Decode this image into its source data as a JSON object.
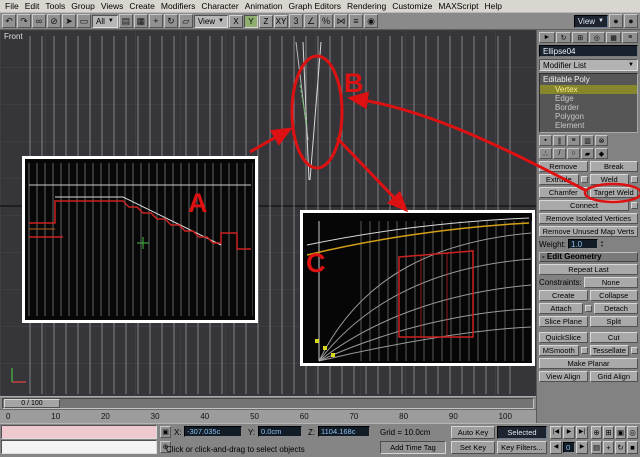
{
  "menu": {
    "items": [
      "File",
      "Edit",
      "Tools",
      "Group",
      "Views",
      "Create",
      "Modifiers",
      "Character",
      "Animation",
      "Graph Editors",
      "Rendering",
      "Customize",
      "MAXScript",
      "Help"
    ]
  },
  "toolbar": {
    "icons_left": [
      "↶",
      "↷",
      "∞",
      "⊘",
      "➤",
      "▭"
    ],
    "filter_label": "All",
    "icons_sel": [
      "▤",
      "▦"
    ],
    "icons_xform": [
      "+",
      "↻",
      "▱"
    ],
    "ref_coord_label": "View",
    "axis_x": "X",
    "axis_y": "Y",
    "axis_z": "Z",
    "axis_xy": "XY",
    "icons_snap": [
      "3",
      "∠",
      "%"
    ],
    "icons_misc": [
      "⋈",
      "≡",
      "◉"
    ],
    "view_label": "View",
    "icons_right": [
      "●",
      "●"
    ]
  },
  "viewport": {
    "label": "Front"
  },
  "annotations": {
    "a_label": "A",
    "b_label": "B",
    "c_label": "C"
  },
  "command_panel": {
    "tabs": [
      "►",
      "↻",
      "⊞",
      "◎",
      "▦",
      "≡"
    ],
    "object_name": "Ellipse04",
    "modifier_list_label": "Modifier List",
    "stack": {
      "root": "Editable Poly",
      "items": [
        "Vertex",
        "Edge",
        "Border",
        "Polygon",
        "Element"
      ]
    },
    "stack_tools": [
      "▪",
      "∥",
      "≡",
      "▥",
      "⊗"
    ],
    "selection_icons": [
      "∴",
      "/",
      "○",
      "▰",
      "◆"
    ],
    "edit_vertices": {
      "remove": "Remove",
      "break": "Break",
      "extrude": "Extrude",
      "weld": "Weld",
      "chamfer": "Chamfer",
      "target_weld": "Target Weld",
      "connect": "Connect",
      "remove_isolated": "Remove Isolated Vertices",
      "remove_unused": "Remove Unused Map Verts",
      "weight_label": "Weight:",
      "weight_value": "1.0"
    },
    "edit_geometry": {
      "header": "- Edit Geometry",
      "repeat_last": "Repeat Last",
      "constraints_label": "Constraints:",
      "constraints_value": "None",
      "create": "Create",
      "collapse": "Collapse",
      "attach": "Attach",
      "detach": "Detach",
      "slice_plane": "Slice Plane",
      "split": "Split",
      "quickslice": "QuickSlice",
      "cut": "Cut",
      "msmooth": "MSmooth",
      "tessellate": "Tessellate",
      "make_planar": "Make Planar",
      "view_align": "View Align",
      "grid_align": "Grid Align"
    }
  },
  "timeline": {
    "slider_label": "0 / 100",
    "ticks": [
      "0",
      "10",
      "20",
      "30",
      "40",
      "50",
      "60",
      "70",
      "80",
      "90",
      "100"
    ]
  },
  "status_bar": {
    "x_label": "X:",
    "x_value": "-307.035c",
    "y_label": "Y:",
    "y_value": "0.0cm",
    "z_label": "Z:",
    "z_value": "1104.168c",
    "grid_label": "Grid = 10.0cm",
    "prompt": "Click or click-and-drag to select objects",
    "add_time_tag": "Add Time Tag",
    "auto_key": "Auto Key",
    "set_key": "Set Key",
    "selected": "Selected",
    "key_filters": "Key Filters...",
    "frame_value": "0",
    "transport": {
      "go_start": "|◀",
      "play": "▶",
      "go_end": "▶|",
      "back": "◀",
      "fwd": "▶"
    },
    "nav_row1": [
      "⊕",
      "⊞",
      "▣",
      "◎"
    ],
    "nav_row2": [
      "▤",
      "+",
      "↻",
      "■"
    ]
  }
}
